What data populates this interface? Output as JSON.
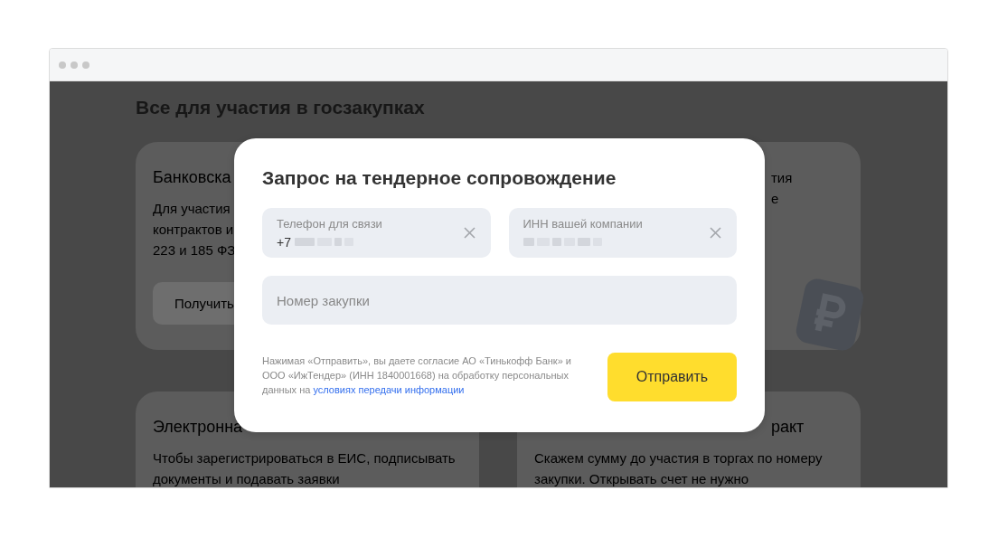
{
  "page": {
    "heading": "Все для участия в госзакупках",
    "cards": [
      {
        "title": "Банковска",
        "lines": [
          "Для участия",
          "контрактов и",
          "223 и 185 ФЗ"
        ],
        "button": "Получить"
      },
      {
        "line_tails": [
          "тия",
          "е"
        ]
      },
      {
        "title": "Электронна",
        "lines": [
          "Чтобы зарегистрироваться в ЕИС, подписывать",
          "документы и подавать заявки"
        ]
      },
      {
        "title_tail": "ракт",
        "lines": [
          "Скажем сумму до участия в торгах по номеру",
          "закупки. Открывать счет не нужно"
        ]
      }
    ]
  },
  "dialog": {
    "title": "Запрос на тендерное сопровождение",
    "fields": [
      {
        "label": "Телефон для связи",
        "value": "+7",
        "masked": true,
        "clearable": true
      },
      {
        "label": "ИНН вашей компании",
        "masked": true,
        "clearable": true
      }
    ],
    "purchase_field": {
      "placeholder": "Номер закупки"
    },
    "consent": {
      "text": "Нажимая «Отправить», вы даете согласие АО «Тинькофф Банк» и ООО «ИжТендер» (ИНН 1840001668) на обработку персональных данных на",
      "link": "условиях передачи информации"
    },
    "submit": "Отправить"
  }
}
